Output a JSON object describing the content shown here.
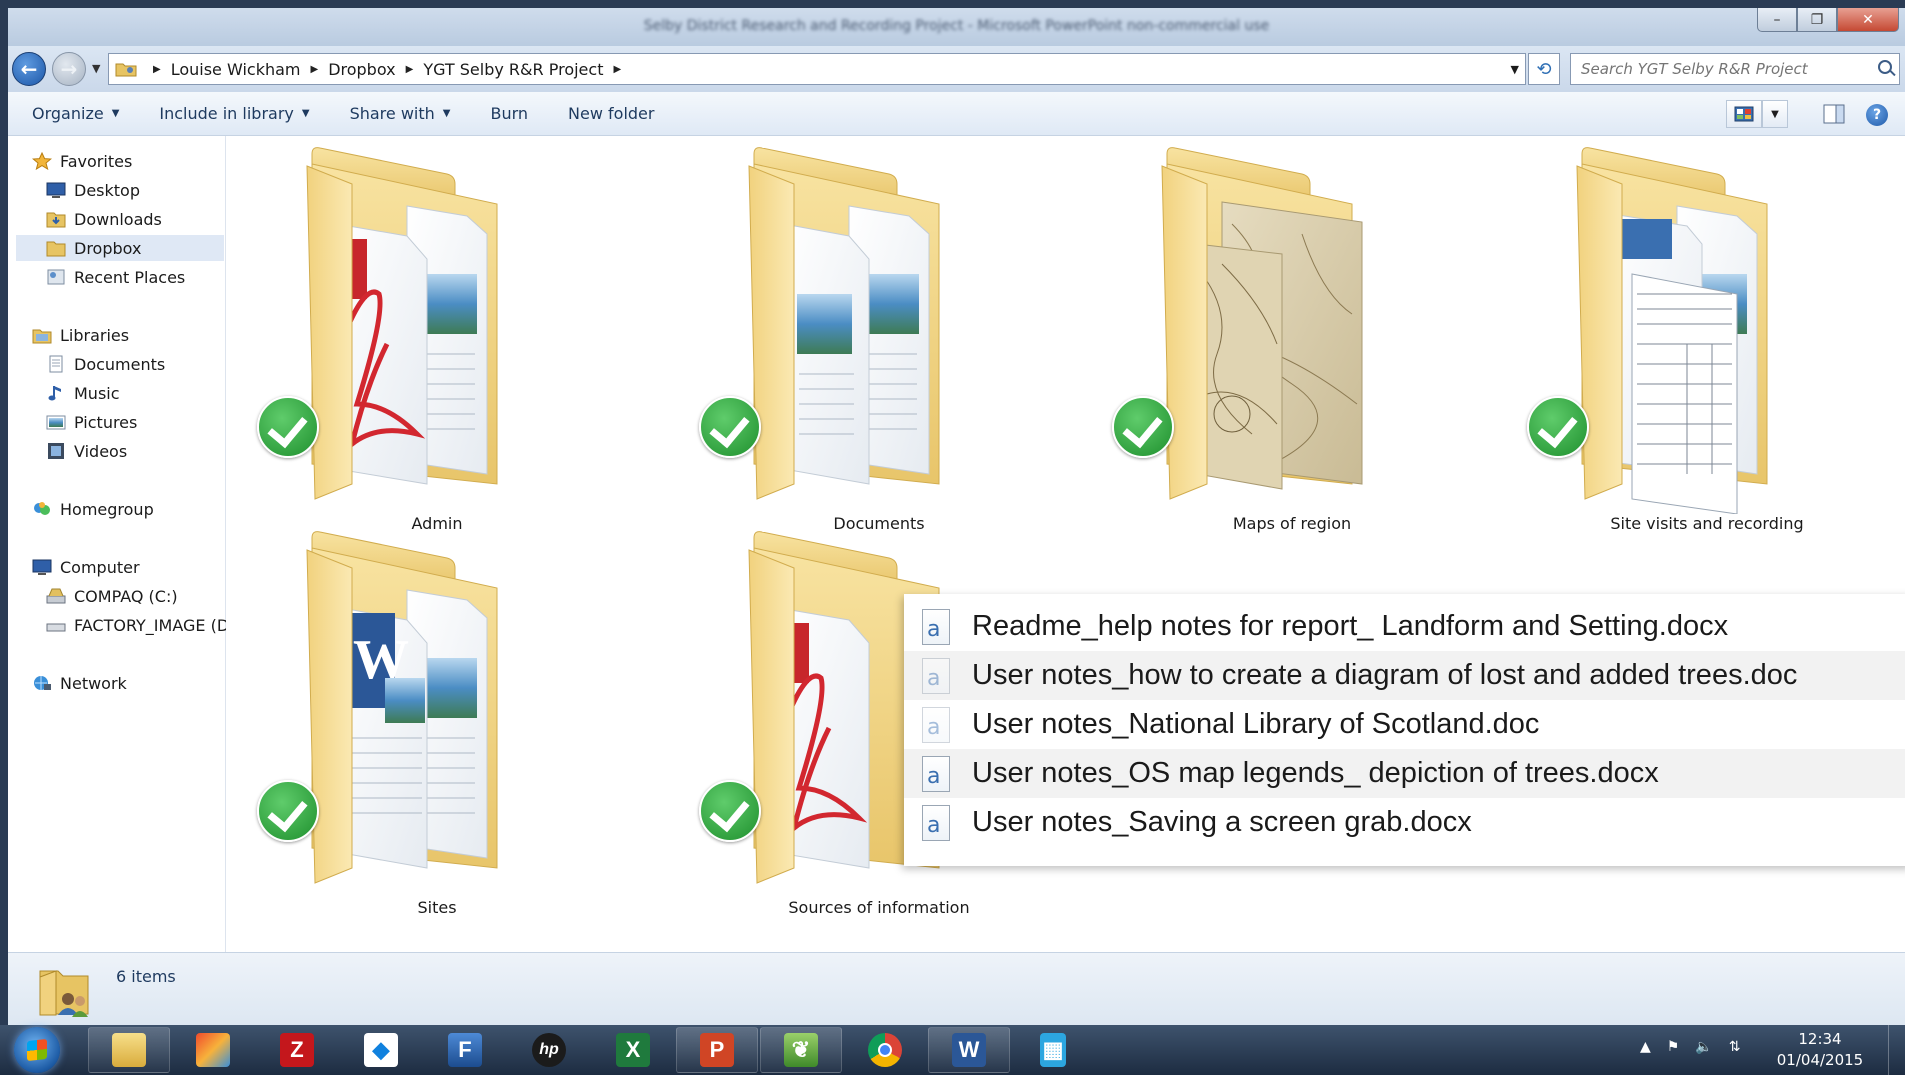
{
  "window": {
    "title": "Selby District Research and Recording Project - Microsoft PowerPoint non-commercial use",
    "minimize_glyph": "–",
    "maximize_glyph": "❐",
    "close_glyph": "✕"
  },
  "nav": {
    "back_glyph": "←",
    "forward_glyph": "→",
    "breadcrumbs": [
      "Louise Wickham",
      "Dropbox",
      "YGT Selby R&R Project"
    ],
    "search_placeholder": "Search YGT Selby R&R Project",
    "refresh_glyph": "⟲"
  },
  "toolbar": {
    "organize": "Organize",
    "include_in_library": "Include in library",
    "share_with": "Share with",
    "burn": "Burn",
    "new_folder": "New folder",
    "help": "?"
  },
  "sidebar": {
    "favorites": "Favorites",
    "desktop": "Desktop",
    "downloads": "Downloads",
    "dropbox": "Dropbox",
    "recent_places": "Recent Places",
    "libraries": "Libraries",
    "documents": "Documents",
    "music": "Music",
    "pictures": "Pictures",
    "videos": "Videos",
    "homegroup": "Homegroup",
    "computer": "Computer",
    "compaq": "COMPAQ (C:)",
    "factory_image": "FACTORY_IMAGE (D",
    "network": "Network"
  },
  "folders": [
    {
      "name": "Admin",
      "content": "pdf-image"
    },
    {
      "name": "Documents",
      "content": "image-docs"
    },
    {
      "name": "Maps of region",
      "content": "maps"
    },
    {
      "name": "Site visits and recording",
      "content": "forms"
    },
    {
      "name": "Sites",
      "content": "word-image"
    },
    {
      "name": "Sources of information",
      "content": "pdf-image"
    }
  ],
  "popup_files": [
    "Readme_help notes for report_ Landform and Setting.docx",
    "User notes_how to create a diagram of lost and added trees.doc",
    "User notes_National Library of Scotland.doc",
    "User notes_OS map legends_ depiction of trees.docx",
    "User notes_Saving a screen grab.docx"
  ],
  "status": {
    "items": "6 items"
  },
  "taskbar": {
    "apps": [
      "explorer",
      "paint-app",
      "filezilla",
      "dropbox",
      "editor",
      "hp",
      "excel",
      "powerpoint",
      "app-green",
      "chrome",
      "word",
      "calculator"
    ],
    "time": "12:34",
    "date": "01/04/2015"
  },
  "colors": {
    "folder": "#f3d888",
    "check": "#2aa53a",
    "accent": "#1c57a8"
  }
}
